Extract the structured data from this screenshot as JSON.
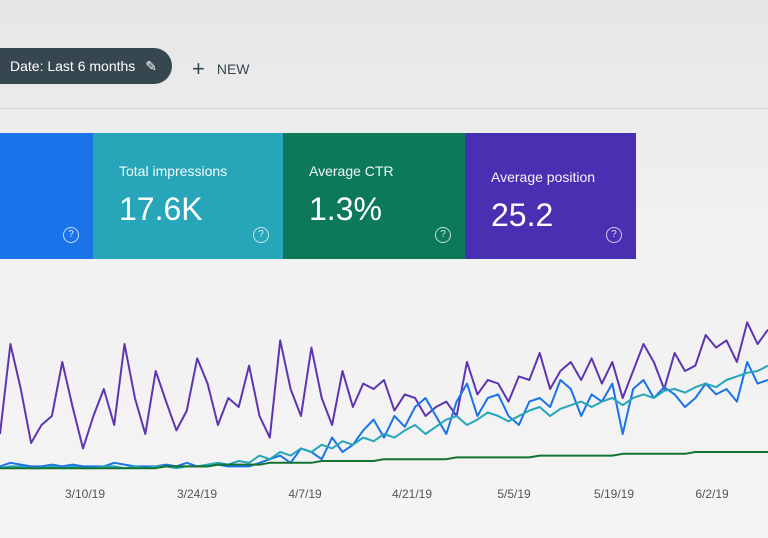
{
  "toolbar": {
    "date_filter_label": "Date: Last 6 months",
    "new_label": "NEW"
  },
  "metrics": [
    {
      "label": "",
      "value": "",
      "color": "#1a73e8"
    },
    {
      "label": "Total impressions",
      "value": "17.6K",
      "color": "#26a6b8"
    },
    {
      "label": "Average CTR",
      "value": "1.3%",
      "color": "#0c7a5a"
    },
    {
      "label": "Average position",
      "value": "25.2",
      "color": "#4a2fb2"
    }
  ],
  "chart_data": {
    "type": "line",
    "x_tick_labels": [
      "3/10/19",
      "3/24/19",
      "4/7/19",
      "4/21/19",
      "5/5/19",
      "5/19/19",
      "6/2/19"
    ],
    "series": [
      {
        "color": "#5e35b1",
        "values": [
          20,
          70,
          45,
          15,
          25,
          30,
          60,
          35,
          12,
          30,
          45,
          25,
          70,
          40,
          20,
          55,
          38,
          22,
          33,
          62,
          48,
          25,
          40,
          35,
          58,
          30,
          18,
          72,
          45,
          30,
          68,
          40,
          25,
          55,
          35,
          48,
          45,
          50,
          33,
          42,
          40,
          30,
          35,
          38,
          30,
          60,
          42,
          50,
          48,
          38,
          52,
          50,
          65,
          45,
          55,
          60,
          50,
          62,
          48,
          60,
          40,
          55,
          70,
          60,
          45,
          65,
          55,
          58,
          75,
          68,
          72,
          60,
          82,
          70,
          78
        ]
      },
      {
        "color": "#1a73e8",
        "values": [
          2,
          4,
          3,
          2,
          2,
          3,
          2,
          3,
          2,
          2,
          2,
          4,
          3,
          2,
          2,
          2,
          3,
          2,
          4,
          2,
          2,
          3,
          2,
          2,
          2,
          4,
          6,
          8,
          4,
          12,
          10,
          6,
          18,
          10,
          14,
          22,
          28,
          18,
          30,
          24,
          35,
          40,
          30,
          20,
          38,
          48,
          30,
          40,
          42,
          30,
          25,
          38,
          40,
          35,
          50,
          45,
          30,
          42,
          38,
          48,
          20,
          45,
          50,
          40,
          46,
          42,
          35,
          40,
          48,
          42,
          45,
          38,
          60,
          48,
          50
        ]
      },
      {
        "color": "#26a6b8",
        "values": [
          1,
          2,
          2,
          1,
          1,
          2,
          1,
          2,
          1,
          1,
          2,
          2,
          1,
          2,
          1,
          2,
          2,
          1,
          2,
          2,
          3,
          4,
          3,
          5,
          4,
          8,
          6,
          10,
          8,
          12,
          10,
          14,
          12,
          16,
          14,
          18,
          16,
          20,
          18,
          22,
          25,
          20,
          24,
          28,
          30,
          25,
          28,
          32,
          30,
          27,
          30,
          33,
          35,
          30,
          34,
          36,
          38,
          35,
          38,
          40,
          36,
          40,
          42,
          40,
          44,
          45,
          43,
          46,
          48,
          46,
          50,
          52,
          54,
          55,
          58
        ]
      },
      {
        "color": "#137333",
        "values": [
          1,
          1,
          1,
          1,
          1,
          1,
          1,
          1,
          1,
          1,
          1,
          1,
          1,
          1,
          1,
          1,
          2,
          2,
          2,
          2,
          2,
          3,
          3,
          3,
          3,
          3,
          4,
          4,
          4,
          4,
          4,
          5,
          5,
          5,
          5,
          5,
          5,
          6,
          6,
          6,
          6,
          6,
          6,
          6,
          7,
          7,
          7,
          7,
          7,
          7,
          7,
          7,
          8,
          8,
          8,
          8,
          8,
          8,
          8,
          8,
          9,
          9,
          9,
          9,
          9,
          9,
          9,
          10,
          10,
          10,
          10,
          10,
          10,
          10,
          10
        ]
      }
    ]
  }
}
